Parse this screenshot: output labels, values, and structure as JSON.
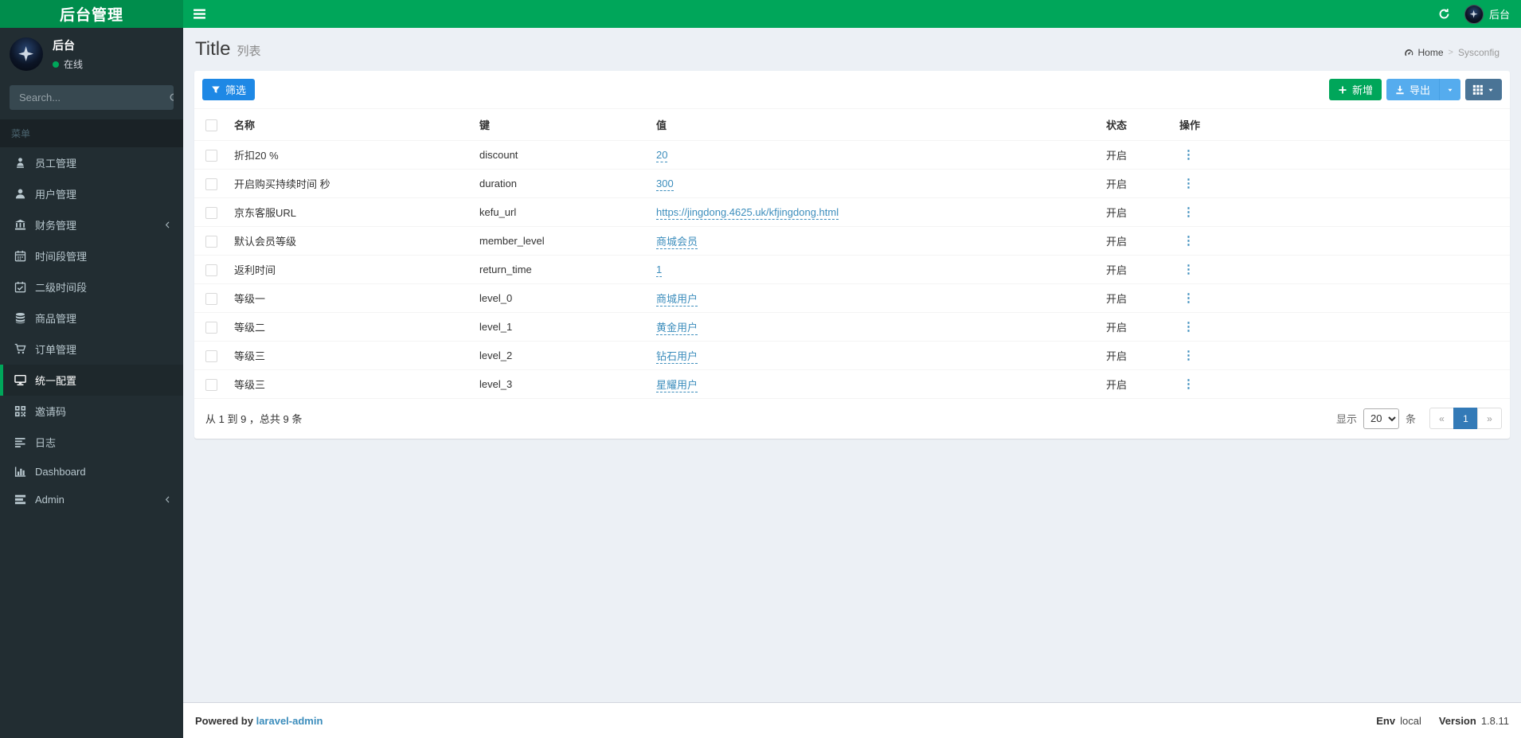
{
  "navbar": {
    "logo": "后台管理",
    "user_label": "后台"
  },
  "sidebar": {
    "user": {
      "name": "后台",
      "status": "在线"
    },
    "search_placeholder": "Search...",
    "menu_header": "菜单",
    "items": [
      {
        "id": "staff",
        "label": "员工管理",
        "icon": "staff-icon",
        "active": false,
        "has_children": false
      },
      {
        "id": "users",
        "label": "用户管理",
        "icon": "user-icon",
        "active": false,
        "has_children": false
      },
      {
        "id": "finance",
        "label": "财务管理",
        "icon": "bank-icon",
        "active": false,
        "has_children": true
      },
      {
        "id": "timeslot",
        "label": "时间段管理",
        "icon": "calendar-icon",
        "active": false,
        "has_children": false
      },
      {
        "id": "timeslot2",
        "label": "二级时间段",
        "icon": "calendar-check-icon",
        "active": false,
        "has_children": false
      },
      {
        "id": "goods",
        "label": "商品管理",
        "icon": "database-icon",
        "active": false,
        "has_children": false
      },
      {
        "id": "orders",
        "label": "订单管理",
        "icon": "cart-icon",
        "active": false,
        "has_children": false
      },
      {
        "id": "sysconfig",
        "label": "统一配置",
        "icon": "desktop-icon",
        "active": true,
        "has_children": false
      },
      {
        "id": "invite",
        "label": "邀请码",
        "icon": "qrcode-icon",
        "active": false,
        "has_children": false
      },
      {
        "id": "log",
        "label": "日志",
        "icon": "log-icon",
        "active": false,
        "has_children": false
      },
      {
        "id": "dashboard",
        "label": "Dashboard",
        "icon": "chart-icon",
        "active": false,
        "has_children": false
      },
      {
        "id": "admin",
        "label": "Admin",
        "icon": "tasks-icon",
        "active": false,
        "has_children": true
      }
    ]
  },
  "content_header": {
    "title": "Title",
    "subtitle": "列表",
    "breadcrumb": {
      "home": "Home",
      "separator": ">",
      "current": "Sysconfig"
    }
  },
  "toolbar": {
    "filter_label": "筛选",
    "create_label": "新增",
    "export_label": "导出"
  },
  "table": {
    "columns": {
      "name": "名称",
      "key": "键",
      "value": "值",
      "status": "状态",
      "action": "操作"
    },
    "rows": [
      {
        "name": "折扣20 %",
        "key": "discount",
        "value": "20",
        "status": "开启"
      },
      {
        "name": "开启购买持续时间 秒",
        "key": "duration",
        "value": "300",
        "status": "开启"
      },
      {
        "name": "京东客服URL",
        "key": "kefu_url",
        "value": "https://jingdong.4625.uk/kfjingdong.html",
        "status": "开启"
      },
      {
        "name": "默认会员等级",
        "key": "member_level",
        "value": "商城会员",
        "status": "开启"
      },
      {
        "name": "返利时间",
        "key": "return_time",
        "value": "1",
        "status": "开启"
      },
      {
        "name": "等级一",
        "key": "level_0",
        "value": "商城用户",
        "status": "开启"
      },
      {
        "name": "等级二",
        "key": "level_1",
        "value": "黄金用户",
        "status": "开启"
      },
      {
        "name": "等级三",
        "key": "level_2",
        "value": "钻石用户",
        "status": "开启"
      },
      {
        "name": "等级三",
        "key": "level_3",
        "value": "星耀用户",
        "status": "开启"
      }
    ]
  },
  "table_footer": {
    "summary": "从 1 到 9 ，总共 9 条",
    "per_page_prefix": "显示",
    "per_page_value": "20",
    "per_page_suffix": "条",
    "pager": {
      "prev": "«",
      "page": "1",
      "next": "»"
    }
  },
  "footer": {
    "powered_by": "Powered by",
    "powered_link": "laravel-admin",
    "env_label": "Env",
    "env_value": "local",
    "version_label": "Version",
    "version_value": "1.8.11"
  },
  "colors": {
    "navbar_green": "#00a65a",
    "logo_green": "#008d4c",
    "sidebar_bg": "#222d32",
    "sidebar_active_bg": "#1e282c",
    "link_blue": "#3c8dbc",
    "filter_button": "#1e88e5",
    "export_button": "#55acee",
    "grid_button": "#4a7496",
    "pager_active": "#337ab7",
    "content_bg": "#ecf0f5"
  }
}
